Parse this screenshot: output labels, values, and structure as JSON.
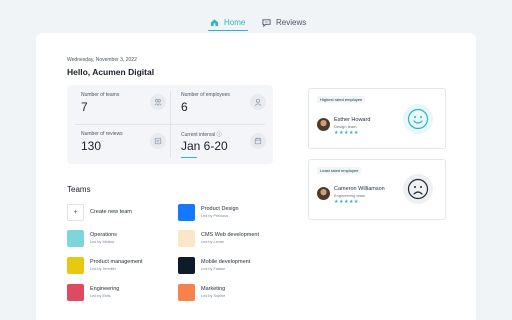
{
  "nav": {
    "tabs": [
      {
        "label": "Home",
        "icon": "home-icon",
        "active": true
      },
      {
        "label": "Reviews",
        "icon": "speech-bubble-icon",
        "active": false
      }
    ]
  },
  "dashboard": {
    "date": "Wednesday, November 3, 2022",
    "greeting": "Hello, Acumen Digital",
    "stats": [
      {
        "label": "Number of teams",
        "value": "7",
        "icon": "teams-icon"
      },
      {
        "label": "Number of employees",
        "value": "6",
        "icon": "employees-icon"
      },
      {
        "label": "Number of reviews",
        "value": "130",
        "icon": "reviews-icon"
      },
      {
        "label": "Current interval ⓘ",
        "value": "Jan 6-20",
        "icon": "calendar-icon"
      }
    ]
  },
  "teams": {
    "title": "Teams",
    "create_label": "Create new team",
    "items": [
      {
        "name": "Product Design",
        "lead": "Led by Precious",
        "color": "#1479ff"
      },
      {
        "name": "Operations",
        "lead": "Led by Mellow",
        "color": "#7dd6dc"
      },
      {
        "name": "CMS Web development",
        "lead": "Led by Lenne",
        "color": "#fbe6c8"
      },
      {
        "name": "Product management",
        "lead": "Led by Jennifer",
        "color": "#e8c810"
      },
      {
        "name": "Mobile development",
        "lead": "Led by Fatase",
        "color": "#0d1b2a"
      },
      {
        "name": "Engineering",
        "lead": "Led by Elvis",
        "color": "#e04a60"
      },
      {
        "name": "Marketing",
        "lead": "Led by Sophie",
        "color": "#f7824c"
      }
    ]
  },
  "highest": {
    "badge": "Highest rated employee",
    "name": "Esther Howard",
    "team": "Design team",
    "stars": "★★★★★",
    "face_icon": "happy-face-icon",
    "accent": "#2bb6c0"
  },
  "lowest": {
    "badge": "Least rated employee",
    "name": "Cameron Williamson",
    "team": "Engineering team",
    "stars": "★★★★★",
    "face_icon": "sad-face-icon"
  }
}
